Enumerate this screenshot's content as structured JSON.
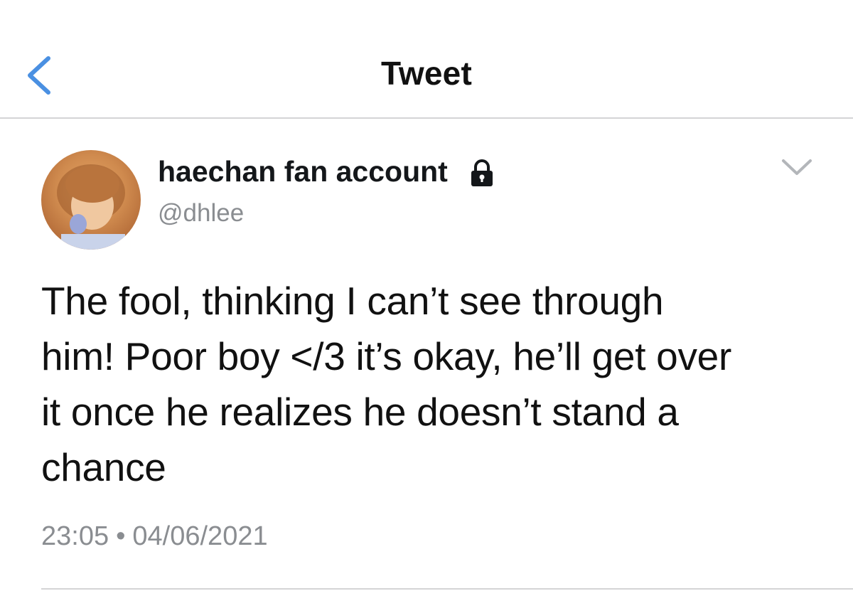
{
  "header": {
    "title": "Tweet",
    "back_icon": "chevron-left-icon"
  },
  "tweet": {
    "author_name": "haechan fan account",
    "locked_icon": "lock-icon",
    "handle": "@dhlee",
    "more_icon": "chevron-down-icon",
    "text_lines": [
      "The fool, thinking I can’t see through",
      "him! Poor boy </3 it’s okay, he’ll get over",
      "it once he realizes he doesn’t stand a",
      "chance"
    ],
    "time": "23:05",
    "separator": "•",
    "date": "04/06/2021"
  },
  "colors": {
    "accent_blue": "#4a90e2",
    "muted_gray": "#8a8d91",
    "divider": "#d4d4d6"
  }
}
